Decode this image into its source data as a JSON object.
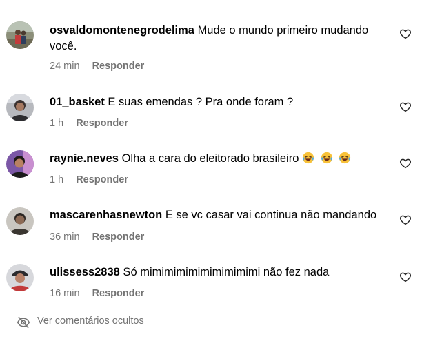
{
  "comments": [
    {
      "username": "osvaldomontenegrodelima",
      "text": "Mude o mundo primeiro mudando você.",
      "time": "24 min",
      "reply_label": "Responder"
    },
    {
      "username": "01_basket",
      "text": "E suas emendas ? Pra onde foram ?",
      "time": "1 h",
      "reply_label": "Responder"
    },
    {
      "username": "raynie.neves",
      "text": "Olha a cara do eleitorado brasileiro",
      "emojis": [
        "laughing-crying-emoji",
        "laughing-crying-emoji",
        "laughing-crying-emoji"
      ],
      "time": "1 h",
      "reply_label": "Responder"
    },
    {
      "username": "mascarenhasnewton",
      "text": "E se vc casar vai continua não mandando",
      "time": "36 min",
      "reply_label": "Responder"
    },
    {
      "username": "ulissess2838",
      "text": "Só mimimimimimimimimimi não fez nada",
      "time": "16 min",
      "reply_label": "Responder"
    }
  ],
  "hidden_comments_label": "Ver comentários ocultos",
  "icons": {
    "like": "heart-outline-icon",
    "hidden": "eye-slash-icon"
  },
  "colors": {
    "text": "#000000",
    "meta": "#737373"
  }
}
